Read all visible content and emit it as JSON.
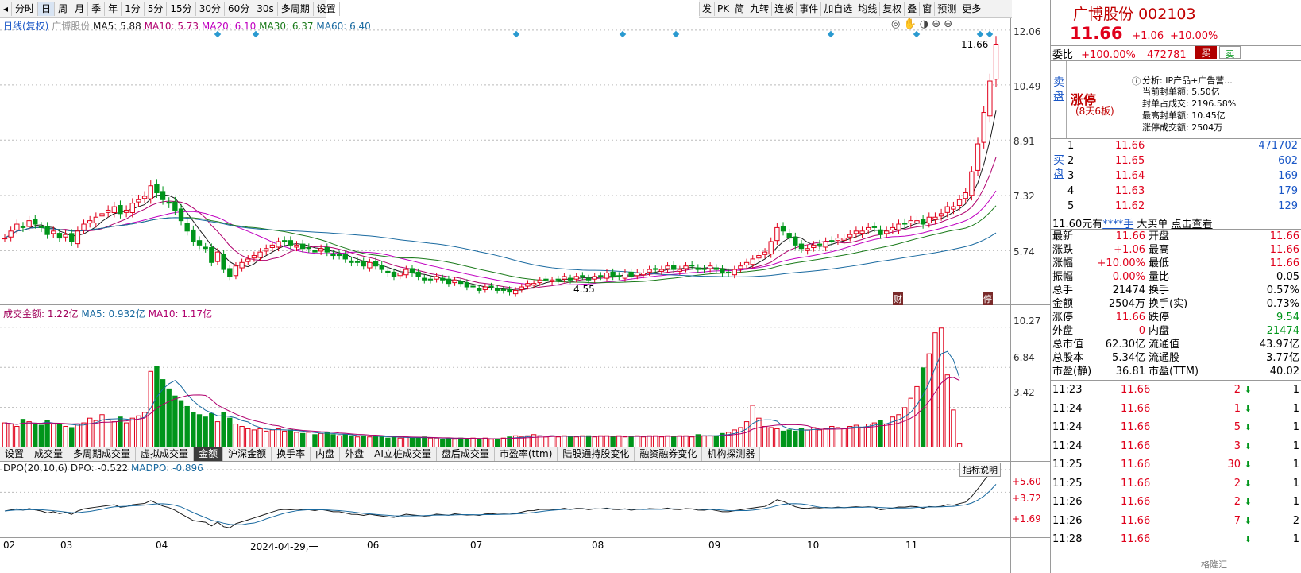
{
  "toolbar": {
    "items": [
      "分时",
      "日",
      "周",
      "月",
      "季",
      "年",
      "1分",
      "5分",
      "15分",
      "30分",
      "60分",
      "30s",
      "多周期",
      "设置"
    ],
    "active": "日"
  },
  "right_toolbar": {
    "items": [
      "发",
      "PK",
      "简",
      "九转",
      "连板",
      "事件",
      "加自选",
      "均线",
      "复权",
      "叠",
      "窗",
      "预测",
      "更多"
    ]
  },
  "main_legend": {
    "period": "日线(复权)",
    "name": "广博股份",
    "ma5": "MA5: 5.88",
    "ma10": "MA10: 5.73",
    "ma20": "MA20: 6.10",
    "ma30": "MA30: 6.37",
    "ma60": "MA60: 6.40"
  },
  "price_axis": [
    "12.06",
    "10.49",
    "8.91",
    "7.32",
    "5.74"
  ],
  "high_mark": "11.66",
  "low_mark": "4.55",
  "markers": {
    "cai": "财",
    "ting": "停"
  },
  "volume_legend": {
    "label": "成交金额: 1.22亿",
    "ma5": "MA5: 0.932亿",
    "ma10": "MA10: 1.17亿"
  },
  "volume_axis": [
    "10.27",
    "6.84",
    "3.42"
  ],
  "indicator_tabs": [
    "设置",
    "成交量",
    "多周期成交量",
    "虚拟成交量",
    "金额",
    "沪深金额",
    "换手率",
    "内盘",
    "外盘",
    "AI立桩成交量",
    "盘后成交量",
    "市盈率(ttm)",
    "陆股通持股变化",
    "融资融券变化",
    "机构探测器"
  ],
  "active_tab": "金额",
  "dpo_legend": {
    "label": "DPO(20,10,6) DPO: -0.522",
    "madpo": "MADPO: -0.896"
  },
  "dpo_axis": [
    "+5.60",
    "+3.72",
    "+1.69"
  ],
  "indicator_help": "指标说明",
  "date_axis": [
    "02",
    "03",
    "04",
    "2024-04-29,一",
    "06",
    "07",
    "08",
    "09",
    "10",
    "11"
  ],
  "stock": {
    "name": "广博股份",
    "code": "002103",
    "price": "11.66",
    "change": "+1.06",
    "pct": "+10.00%"
  },
  "weibi": {
    "label": "委比",
    "pct": "+100.00%",
    "vol": "472781",
    "buy": "买",
    "sell": "卖"
  },
  "limit_up": {
    "title": "涨停",
    "sub": "(8天6板)",
    "analysis": "分析: IP产品+广告营...",
    "lines": [
      "当前封单额: 5.50亿",
      "封单占成交: 2196.58%",
      "最高封单额: 10.45亿",
      "涨停成交额: 2504万"
    ]
  },
  "ask_label": "卖盘",
  "bid_label": "买盘",
  "bids": [
    [
      "1",
      "11.66",
      "471702"
    ],
    [
      "2",
      "11.65",
      "602"
    ],
    [
      "3",
      "11.64",
      "169"
    ],
    [
      "4",
      "11.63",
      "179"
    ],
    [
      "5",
      "11.62",
      "129"
    ]
  ],
  "bigbuy": {
    "a": "11.60元有",
    "b": "****手",
    "c": "大买单",
    "d": "点击查看"
  },
  "quote": [
    [
      "最新",
      "11.66",
      "开盘",
      "11.66"
    ],
    [
      "涨跌",
      "+1.06",
      "最高",
      "11.66"
    ],
    [
      "涨幅",
      "+10.00%",
      "最低",
      "11.66"
    ],
    [
      "振幅",
      "0.00%",
      "量比",
      "0.05"
    ],
    [
      "总手",
      "21474",
      "换手",
      "0.57%"
    ],
    [
      "金额",
      "2504万",
      "换手(实)",
      "0.73%"
    ],
    [
      "涨停",
      "11.66",
      "跌停",
      "9.54"
    ],
    [
      "外盘",
      "0",
      "内盘",
      "21474"
    ],
    [
      "总市值",
      "62.30亿",
      "流通值",
      "43.97亿"
    ],
    [
      "总股本",
      "5.34亿",
      "流通股",
      "3.77亿"
    ],
    [
      "市盈(静)",
      "36.81",
      "市盈(TTM)",
      "40.02"
    ]
  ],
  "trades": [
    [
      "11:23",
      "11.66",
      "2",
      "1"
    ],
    [
      "11:24",
      "11.66",
      "1",
      "1"
    ],
    [
      "11:24",
      "11.66",
      "5",
      "1"
    ],
    [
      "11:24",
      "11.66",
      "3",
      "1"
    ],
    [
      "11:25",
      "11.66",
      "30",
      "1"
    ],
    [
      "11:25",
      "11.66",
      "2",
      "1"
    ],
    [
      "11:26",
      "11.66",
      "2",
      "1"
    ],
    [
      "11:26",
      "11.66",
      "7",
      "2"
    ],
    [
      "11:28",
      "11.66",
      "",
      "1"
    ]
  ],
  "colors": {
    "up": "#e0001b",
    "down": "#00951a",
    "ma5": "#1a1a1a",
    "ma10": "#b0006e",
    "ma20": "#c000c0",
    "ma30": "#1a7a1a",
    "ma60": "#1a6aa0"
  },
  "watermark": "格隆汇",
  "chart_data": {
    "type": "candlestick",
    "count": 200,
    "price_range": [
      4.2,
      12.4
    ],
    "closes": [
      6.1,
      6.3,
      6.5,
      6.4,
      6.6,
      6.5,
      6.4,
      6.2,
      6.3,
      6.1,
      6.2,
      6.0,
      6.3,
      6.5,
      6.6,
      6.7,
      6.8,
      6.9,
      7.0,
      6.8,
      6.9,
      7.1,
      7.2,
      7.3,
      7.6,
      7.4,
      7.2,
      7.1,
      6.9,
      6.6,
      6.3,
      6.0,
      5.9,
      5.8,
      5.4,
      5.7,
      5.2,
      5.0,
      5.3,
      5.4,
      5.5,
      5.6,
      5.7,
      5.8,
      5.9,
      6.0,
      6.0,
      5.9,
      5.9,
      5.8,
      5.8,
      5.7,
      5.8,
      5.7,
      5.6,
      5.6,
      5.5,
      5.4,
      5.4,
      5.3,
      5.4,
      5.3,
      5.2,
      5.1,
      5.0,
      5.1,
      5.2,
      5.1,
      5.0,
      4.9,
      4.9,
      5.0,
      4.9,
      4.8,
      4.9,
      4.8,
      4.7,
      4.7,
      4.6,
      4.7,
      4.7,
      4.6,
      4.6,
      4.55,
      4.6,
      4.7,
      4.8,
      4.8,
      4.9,
      4.9,
      4.9,
      4.9,
      5.0,
      4.9,
      5.0,
      5.0,
      4.9,
      5.0,
      5.0,
      5.1,
      5.0,
      5.0,
      5.1,
      5.0,
      5.1,
      5.1,
      5.2,
      5.2,
      5.2,
      5.3,
      5.2,
      5.2,
      5.3,
      5.3,
      5.2,
      5.2,
      5.3,
      5.2,
      5.1,
      5.1,
      5.2,
      5.3,
      5.4,
      5.5,
      5.6,
      5.7,
      6.0,
      6.4,
      6.3,
      6.1,
      5.9,
      5.8,
      5.8,
      5.9,
      5.9,
      6.0,
      6.0,
      6.1,
      6.1,
      6.2,
      6.3,
      6.3,
      6.4,
      6.4,
      6.2,
      6.3,
      6.4,
      6.5,
      6.5,
      6.6,
      6.6,
      6.5,
      6.7,
      6.7,
      6.8,
      7.0,
      7.0,
      7.2,
      7.4,
      8.0,
      8.8,
      9.7,
      10.6,
      11.66
    ],
    "volumes": [
      2.1,
      2.0,
      1.8,
      2.4,
      2.2,
      2.0,
      1.9,
      2.3,
      2.0,
      2.0,
      1.8,
      1.7,
      2.0,
      2.1,
      2.5,
      2.3,
      2.8,
      2.4,
      2.2,
      2.6,
      2.1,
      2.5,
      2.7,
      3.0,
      6.5,
      6.9,
      5.8,
      5.0,
      4.4,
      4.0,
      3.5,
      3.0,
      2.8,
      2.6,
      2.9,
      2.2,
      3.0,
      2.5,
      2.0,
      1.8,
      1.6,
      1.5,
      1.6,
      1.4,
      1.5,
      1.6,
      1.4,
      1.5,
      1.3,
      1.2,
      1.3,
      1.1,
      1.2,
      1.3,
      1.1,
      1.0,
      1.1,
      1.0,
      0.9,
      1.0,
      0.9,
      1.0,
      0.9,
      0.8,
      0.9,
      0.8,
      0.9,
      0.8,
      0.8,
      0.9,
      0.8,
      0.8,
      0.7,
      0.8,
      0.7,
      0.8,
      0.7,
      0.8,
      0.7,
      0.8,
      0.7,
      0.7,
      0.8,
      0.9,
      1.0,
      0.9,
      1.0,
      1.1,
      1.0,
      0.9,
      1.0,
      0.9,
      1.0,
      0.9,
      0.9,
      1.0,
      1.0,
      0.9,
      1.0,
      1.0,
      0.9,
      1.0,
      0.9,
      0.9,
      1.0,
      0.9,
      1.0,
      1.0,
      0.9,
      1.0,
      0.9,
      1.0,
      1.0,
      0.9,
      1.1,
      1.0,
      1.0,
      1.0,
      1.2,
      1.3,
      1.5,
      1.7,
      2.2,
      3.6,
      2.5,
      1.8,
      1.7,
      1.6,
      1.4,
      1.5,
      1.4,
      1.6,
      1.5,
      1.7,
      1.5,
      1.6,
      1.8,
      1.7,
      1.6,
      1.8,
      1.9,
      1.7,
      2.0,
      2.1,
      2.3,
      2.0,
      2.6,
      2.8,
      3.4,
      4.2,
      5.2,
      6.8,
      8.0,
      9.8,
      10.2,
      6.2,
      3.2,
      0.3
    ]
  }
}
